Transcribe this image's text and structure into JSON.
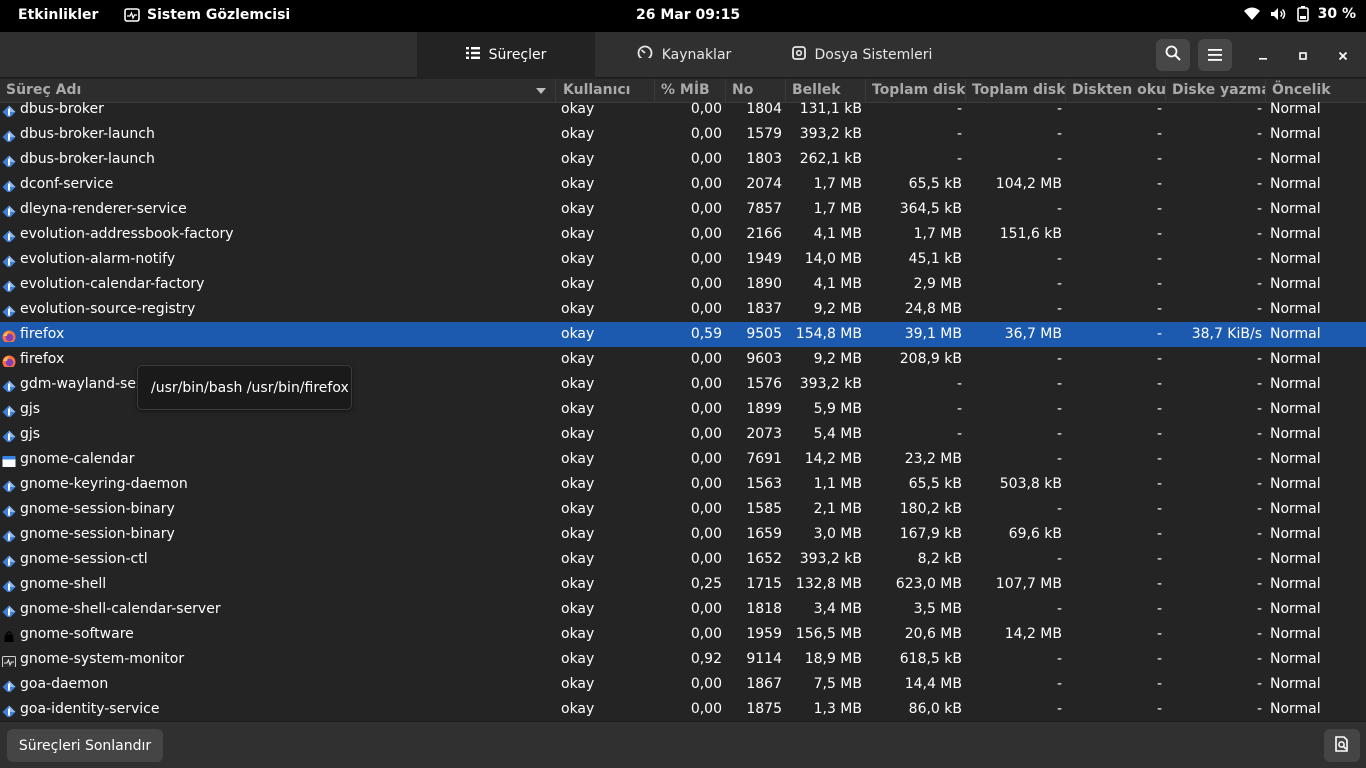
{
  "topbar": {
    "activities": "Etkinlikler",
    "app_name": "Sistem Gözlemcisi",
    "clock": "26 Mar  09:15",
    "battery": "30 %",
    "icons": [
      "wifi-icon",
      "volume-icon",
      "battery-icon"
    ]
  },
  "tabs": [
    {
      "label": "Süreçler",
      "icon": "list-icon",
      "active": true
    },
    {
      "label": "Kaynaklar",
      "icon": "gauge-icon",
      "active": false
    },
    {
      "label": "Dosya Sistemleri",
      "icon": "disk-icon",
      "active": false
    }
  ],
  "columns": [
    "Süreç Adı",
    "Kullanıcı",
    "% MİB",
    "No",
    "Bellek",
    "Toplam diskte",
    "Toplam diske",
    "Diskten okum",
    "Diske yazma",
    "Öncelik"
  ],
  "rows": [
    {
      "name": "dbus-broker",
      "user": "okay",
      "cpu": "0,00",
      "pid": "1804",
      "mem": "131,1 kB",
      "dr": "-",
      "dw": "-",
      "rr": "-",
      "wr": "-",
      "pri": "Normal",
      "icon": "generic",
      "selected": false
    },
    {
      "name": "dbus-broker-launch",
      "user": "okay",
      "cpu": "0,00",
      "pid": "1579",
      "mem": "393,2 kB",
      "dr": "-",
      "dw": "-",
      "rr": "-",
      "wr": "-",
      "pri": "Normal",
      "icon": "generic",
      "selected": false
    },
    {
      "name": "dbus-broker-launch",
      "user": "okay",
      "cpu": "0,00",
      "pid": "1803",
      "mem": "262,1 kB",
      "dr": "-",
      "dw": "-",
      "rr": "-",
      "wr": "-",
      "pri": "Normal",
      "icon": "generic",
      "selected": false
    },
    {
      "name": "dconf-service",
      "user": "okay",
      "cpu": "0,00",
      "pid": "2074",
      "mem": "1,7 MB",
      "dr": "65,5 kB",
      "dw": "104,2 MB",
      "rr": "-",
      "wr": "-",
      "pri": "Normal",
      "icon": "generic",
      "selected": false
    },
    {
      "name": "dleyna-renderer-service",
      "user": "okay",
      "cpu": "0,00",
      "pid": "7857",
      "mem": "1,7 MB",
      "dr": "364,5 kB",
      "dw": "-",
      "rr": "-",
      "wr": "-",
      "pri": "Normal",
      "icon": "generic",
      "selected": false
    },
    {
      "name": "evolution-addressbook-factory",
      "user": "okay",
      "cpu": "0,00",
      "pid": "2166",
      "mem": "4,1 MB",
      "dr": "1,7 MB",
      "dw": "151,6 kB",
      "rr": "-",
      "wr": "-",
      "pri": "Normal",
      "icon": "generic",
      "selected": false
    },
    {
      "name": "evolution-alarm-notify",
      "user": "okay",
      "cpu": "0,00",
      "pid": "1949",
      "mem": "14,0 MB",
      "dr": "45,1 kB",
      "dw": "-",
      "rr": "-",
      "wr": "-",
      "pri": "Normal",
      "icon": "generic",
      "selected": false
    },
    {
      "name": "evolution-calendar-factory",
      "user": "okay",
      "cpu": "0,00",
      "pid": "1890",
      "mem": "4,1 MB",
      "dr": "2,9 MB",
      "dw": "-",
      "rr": "-",
      "wr": "-",
      "pri": "Normal",
      "icon": "generic",
      "selected": false
    },
    {
      "name": "evolution-source-registry",
      "user": "okay",
      "cpu": "0,00",
      "pid": "1837",
      "mem": "9,2 MB",
      "dr": "24,8 MB",
      "dw": "-",
      "rr": "-",
      "wr": "-",
      "pri": "Normal",
      "icon": "generic",
      "selected": false
    },
    {
      "name": "firefox",
      "user": "okay",
      "cpu": "0,59",
      "pid": "9505",
      "mem": "154,8 MB",
      "dr": "39,1 MB",
      "dw": "36,7 MB",
      "rr": "-",
      "wr": "38,7 KiB/s",
      "pri": "Normal",
      "icon": "firefox",
      "selected": true
    },
    {
      "name": "firefox",
      "user": "okay",
      "cpu": "0,00",
      "pid": "9603",
      "mem": "9,2 MB",
      "dr": "208,9 kB",
      "dw": "-",
      "rr": "-",
      "wr": "-",
      "pri": "Normal",
      "icon": "firefox",
      "selected": false
    },
    {
      "name": "gdm-wayland-session",
      "user": "okay",
      "cpu": "0,00",
      "pid": "1576",
      "mem": "393,2 kB",
      "dr": "-",
      "dw": "-",
      "rr": "-",
      "wr": "-",
      "pri": "Normal",
      "icon": "generic",
      "selected": false
    },
    {
      "name": "gjs",
      "user": "okay",
      "cpu": "0,00",
      "pid": "1899",
      "mem": "5,9 MB",
      "dr": "-",
      "dw": "-",
      "rr": "-",
      "wr": "-",
      "pri": "Normal",
      "icon": "generic",
      "selected": false
    },
    {
      "name": "gjs",
      "user": "okay",
      "cpu": "0,00",
      "pid": "2073",
      "mem": "5,4 MB",
      "dr": "-",
      "dw": "-",
      "rr": "-",
      "wr": "-",
      "pri": "Normal",
      "icon": "generic",
      "selected": false
    },
    {
      "name": "gnome-calendar",
      "user": "okay",
      "cpu": "0,00",
      "pid": "7691",
      "mem": "14,2 MB",
      "dr": "23,2 MB",
      "dw": "-",
      "rr": "-",
      "wr": "-",
      "pri": "Normal",
      "icon": "calendar",
      "selected": false
    },
    {
      "name": "gnome-keyring-daemon",
      "user": "okay",
      "cpu": "0,00",
      "pid": "1563",
      "mem": "1,1 MB",
      "dr": "65,5 kB",
      "dw": "503,8 kB",
      "rr": "-",
      "wr": "-",
      "pri": "Normal",
      "icon": "generic",
      "selected": false
    },
    {
      "name": "gnome-session-binary",
      "user": "okay",
      "cpu": "0,00",
      "pid": "1585",
      "mem": "2,1 MB",
      "dr": "180,2 kB",
      "dw": "-",
      "rr": "-",
      "wr": "-",
      "pri": "Normal",
      "icon": "generic",
      "selected": false
    },
    {
      "name": "gnome-session-binary",
      "user": "okay",
      "cpu": "0,00",
      "pid": "1659",
      "mem": "3,0 MB",
      "dr": "167,9 kB",
      "dw": "69,6 kB",
      "rr": "-",
      "wr": "-",
      "pri": "Normal",
      "icon": "generic",
      "selected": false
    },
    {
      "name": "gnome-session-ctl",
      "user": "okay",
      "cpu": "0,00",
      "pid": "1652",
      "mem": "393,2 kB",
      "dr": "8,2 kB",
      "dw": "-",
      "rr": "-",
      "wr": "-",
      "pri": "Normal",
      "icon": "generic",
      "selected": false
    },
    {
      "name": "gnome-shell",
      "user": "okay",
      "cpu": "0,25",
      "pid": "1715",
      "mem": "132,8 MB",
      "dr": "623,0 MB",
      "dw": "107,7 MB",
      "rr": "-",
      "wr": "-",
      "pri": "Normal",
      "icon": "generic",
      "selected": false
    },
    {
      "name": "gnome-shell-calendar-server",
      "user": "okay",
      "cpu": "0,00",
      "pid": "1818",
      "mem": "3,4 MB",
      "dr": "3,5 MB",
      "dw": "-",
      "rr": "-",
      "wr": "-",
      "pri": "Normal",
      "icon": "generic",
      "selected": false
    },
    {
      "name": "gnome-software",
      "user": "okay",
      "cpu": "0,00",
      "pid": "1959",
      "mem": "156,5 MB",
      "dr": "20,6 MB",
      "dw": "14,2 MB",
      "rr": "-",
      "wr": "-",
      "pri": "Normal",
      "icon": "software",
      "selected": false
    },
    {
      "name": "gnome-system-monitor",
      "user": "okay",
      "cpu": "0,92",
      "pid": "9114",
      "mem": "18,9 MB",
      "dr": "618,5 kB",
      "dw": "-",
      "rr": "-",
      "wr": "-",
      "pri": "Normal",
      "icon": "monitor",
      "selected": false
    },
    {
      "name": "goa-daemon",
      "user": "okay",
      "cpu": "0,00",
      "pid": "1867",
      "mem": "7,5 MB",
      "dr": "14,4 MB",
      "dw": "-",
      "rr": "-",
      "wr": "-",
      "pri": "Normal",
      "icon": "generic",
      "selected": false
    },
    {
      "name": "goa-identity-service",
      "user": "okay",
      "cpu": "0,00",
      "pid": "1875",
      "mem": "1,3 MB",
      "dr": "86,0 kB",
      "dw": "-",
      "rr": "-",
      "wr": "-",
      "pri": "Normal",
      "icon": "generic",
      "selected": false
    }
  ],
  "tooltip": "/usr/bin/bash /usr/bin/firefox",
  "bottom": {
    "end_button": "Süreçleri Sonlandır"
  },
  "colors": {
    "selection": "#1c5ab0",
    "background": "#242424",
    "headerbar": "#303030"
  }
}
